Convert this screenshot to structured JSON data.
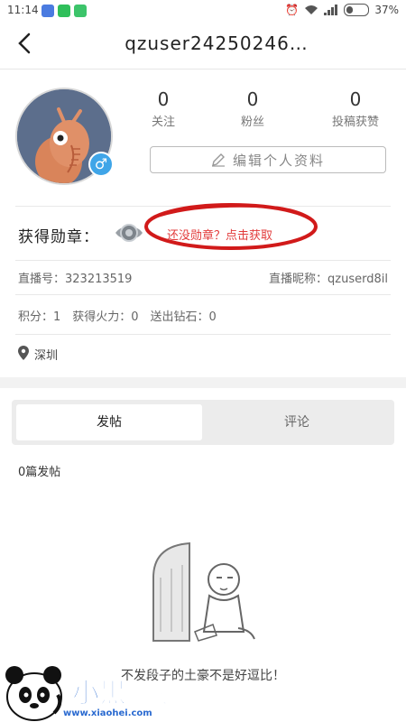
{
  "status_bar": {
    "time": "11:14",
    "battery_text": "37%",
    "battery_level": 0.37
  },
  "header": {
    "title": "qzuser24250246…"
  },
  "profile": {
    "stats": [
      {
        "value": "0",
        "label": "关注"
      },
      {
        "value": "0",
        "label": "粉丝"
      },
      {
        "value": "0",
        "label": "投稿获赞"
      }
    ],
    "edit_button_label": "编辑个人资料",
    "gender_symbol": "♂"
  },
  "badge": {
    "label": "获得勋章：",
    "link_text": "还没勋章？点击获取"
  },
  "info": {
    "live_id_label": "直播号：",
    "live_id_value": "323213519",
    "nickname_label": "直播昵称：",
    "nickname_value": "qzuserd8il",
    "points_line": "积分：1　获得火力：0　送出钻石：0",
    "location": "深圳"
  },
  "tabs": {
    "items": [
      "发帖",
      "评论"
    ],
    "active": "发帖"
  },
  "content": {
    "post_count": "0篇发帖",
    "empty_text": "不发段子的土豪不是好逗比！"
  },
  "watermark": {
    "brand": "小黑游戏",
    "url": "www.xiaohei.com"
  },
  "colors": {
    "accent_red": "#e23c3c",
    "gender_blue": "#3fa5e8",
    "tab_bg": "#ececec"
  }
}
